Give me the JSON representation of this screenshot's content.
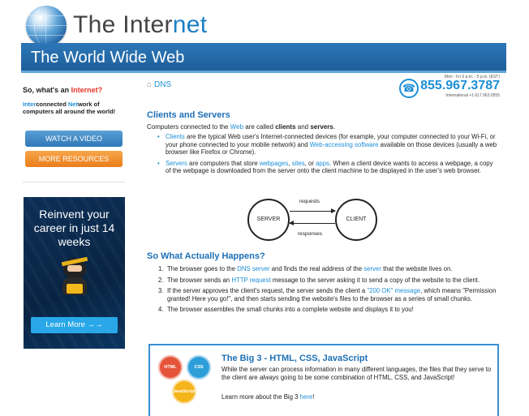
{
  "header": {
    "site_title_prefix": "The Inter",
    "site_title_accent": "net",
    "banner_title": "The World Wide Web"
  },
  "sidebar": {
    "question_prefix": "So, what's an ",
    "question_link": "Internet?",
    "desc_inter": "Inter",
    "desc_1": "connected ",
    "desc_net": "Net",
    "desc_2": "work of computers all around the world!",
    "watch_video": "WATCH A VIDEO",
    "more_resources": "MORE RESOURCES",
    "ad_text": "Reinvent your career in just 14 weeks",
    "ad_button": "Learn More →→"
  },
  "breadcrumb": "DNS",
  "contact": {
    "hours": "Mon - Fri 9 a.m. - 5 p.m. (EST)",
    "phone": "855.967.3787",
    "international": "International +1.617.963.0555"
  },
  "clients_servers": {
    "heading": "Clients and Servers",
    "intro_a": "Computers connected to the ",
    "intro_web": "Web",
    "intro_b": " are called ",
    "intro_clients": "clients",
    "intro_c": " and ",
    "intro_servers": "servers",
    "intro_d": ".",
    "bullet1_link": "Clients",
    "bullet1_a": " are the typical Web user's Internet-connected devices (for example, your computer connected to your Wi-Fi, or your phone connected to your mobile network) and ",
    "bullet1_link2": "Web-accessing software",
    "bullet1_b": " available on those devices (usually a web browser like Firefox or Chrome).",
    "bullet2_link": "Servers",
    "bullet2_a": " are computers that store ",
    "bullet2_l1": "webpages",
    "bullet2_c1": ", ",
    "bullet2_l2": "sites",
    "bullet2_c2": ", or ",
    "bullet2_l3": "apps",
    "bullet2_b": ". When a client device wants to access a webpage, a copy of the webpage is downloaded from the server onto the client machine to be displayed in the user's web browser."
  },
  "diagram": {
    "server": "SERVER",
    "client": "CLIENT",
    "requests": "requests",
    "responses": "responses"
  },
  "happens": {
    "heading": "So What Actually Happens?",
    "step1_num": "1.",
    "step1_a": "The browser goes to the ",
    "step1_l1": "DNS server",
    "step1_b": " and finds the real address of the ",
    "step1_l2": "server",
    "step1_c": " that the website lives on.",
    "step2_num": "2.",
    "step2_a": "The browser sends an ",
    "step2_l1": "HTTP request",
    "step2_b": " message to the server asking it to send a copy of the website to the client.",
    "step3_num": "3.",
    "step3_a": "If the server approves the client's request, the server sends the client a ",
    "step3_l1": "\"200 OK\" message",
    "step3_b": ", which means \"Permission granted! Here you go!\", and then starts sending the website's files to the browser as a series of small chunks.",
    "step4_num": "4.",
    "step4": "The browser assembles the small chunks into a complete website and displays it to you!"
  },
  "big3": {
    "badge_html": "HTML",
    "badge_css": "CSS",
    "badge_js": "JavaScript",
    "heading": "The Big 3 - HTML, CSS, JavaScript",
    "body_a": "While the server can process information in many different languages, the files that they serve to the client are ",
    "body_always": "always",
    "body_b": " going to be some combination of HTML, CSS, and JavaScript!",
    "more_a": "Learn more about the Big 3 ",
    "more_link": "here",
    "more_b": "!"
  },
  "colors": {
    "brand_blue": "#1d7fc4",
    "banner_blue": "#2c77b8",
    "accent_red": "#e2362b",
    "orange": "#ea7d1a"
  }
}
